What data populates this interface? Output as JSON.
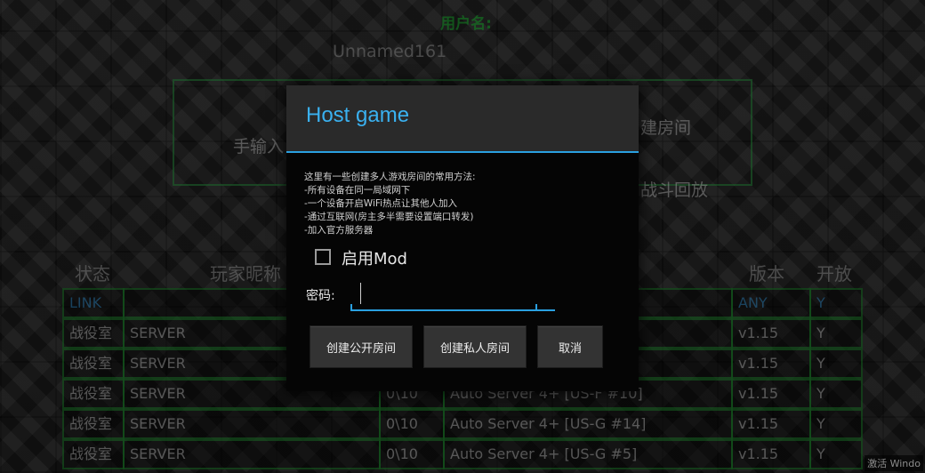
{
  "header": {
    "game_title": "用户名:",
    "player_name": "Unnamed161"
  },
  "menu": {
    "left_option": "手输入",
    "create_room": "建房间",
    "battle_replay": "战斗回放"
  },
  "table": {
    "headers": [
      "状态",
      "玩家昵称",
      "版本",
      "开放"
    ],
    "rows": [
      {
        "status": "LINK",
        "name": "",
        "players": "",
        "map": "",
        "version": "ANY",
        "open": "Y",
        "highlight": true
      },
      {
        "status": "战役室",
        "name": "SERVER",
        "players": "",
        "map": "",
        "version": "v1.15",
        "open": "Y"
      },
      {
        "status": "战役室",
        "name": "SERVER",
        "players": "",
        "map": "",
        "version": "v1.15",
        "open": "Y"
      },
      {
        "status": "战役室",
        "name": "SERVER",
        "players": "0\\10",
        "map": "Auto Server 4+ [US-F #10]",
        "version": "v1.15",
        "open": "Y"
      },
      {
        "status": "战役室",
        "name": "SERVER",
        "players": "0\\10",
        "map": "Auto Server 4+ [US-G #14]",
        "version": "v1.15",
        "open": "Y"
      },
      {
        "status": "战役室",
        "name": "SERVER",
        "players": "0\\10",
        "map": "Auto Server 4+ [US-G #5]",
        "version": "v1.15",
        "open": "Y"
      }
    ]
  },
  "dialog": {
    "title": "Host game",
    "message_lines": [
      "这里有一些创建多人游戏房间的常用方法:",
      "-所有设备在同一局域网下",
      "-一个设备开启WiFi热点让其他人加入",
      "-通过互联网(房主多半需要设置端口转发)",
      "-加入官方服务器"
    ],
    "enable_mod_label": "启用Mod",
    "password_label": "密码:",
    "password_value": "",
    "btn_public": "创建公开房间",
    "btn_private": "创建私人房间",
    "btn_cancel": "取消"
  },
  "watermark": "激活 Windo",
  "colors": {
    "accent_blue": "#2aa0e0",
    "table_border_green": "#1f8e2e",
    "title_green": "#1fdc3a"
  }
}
